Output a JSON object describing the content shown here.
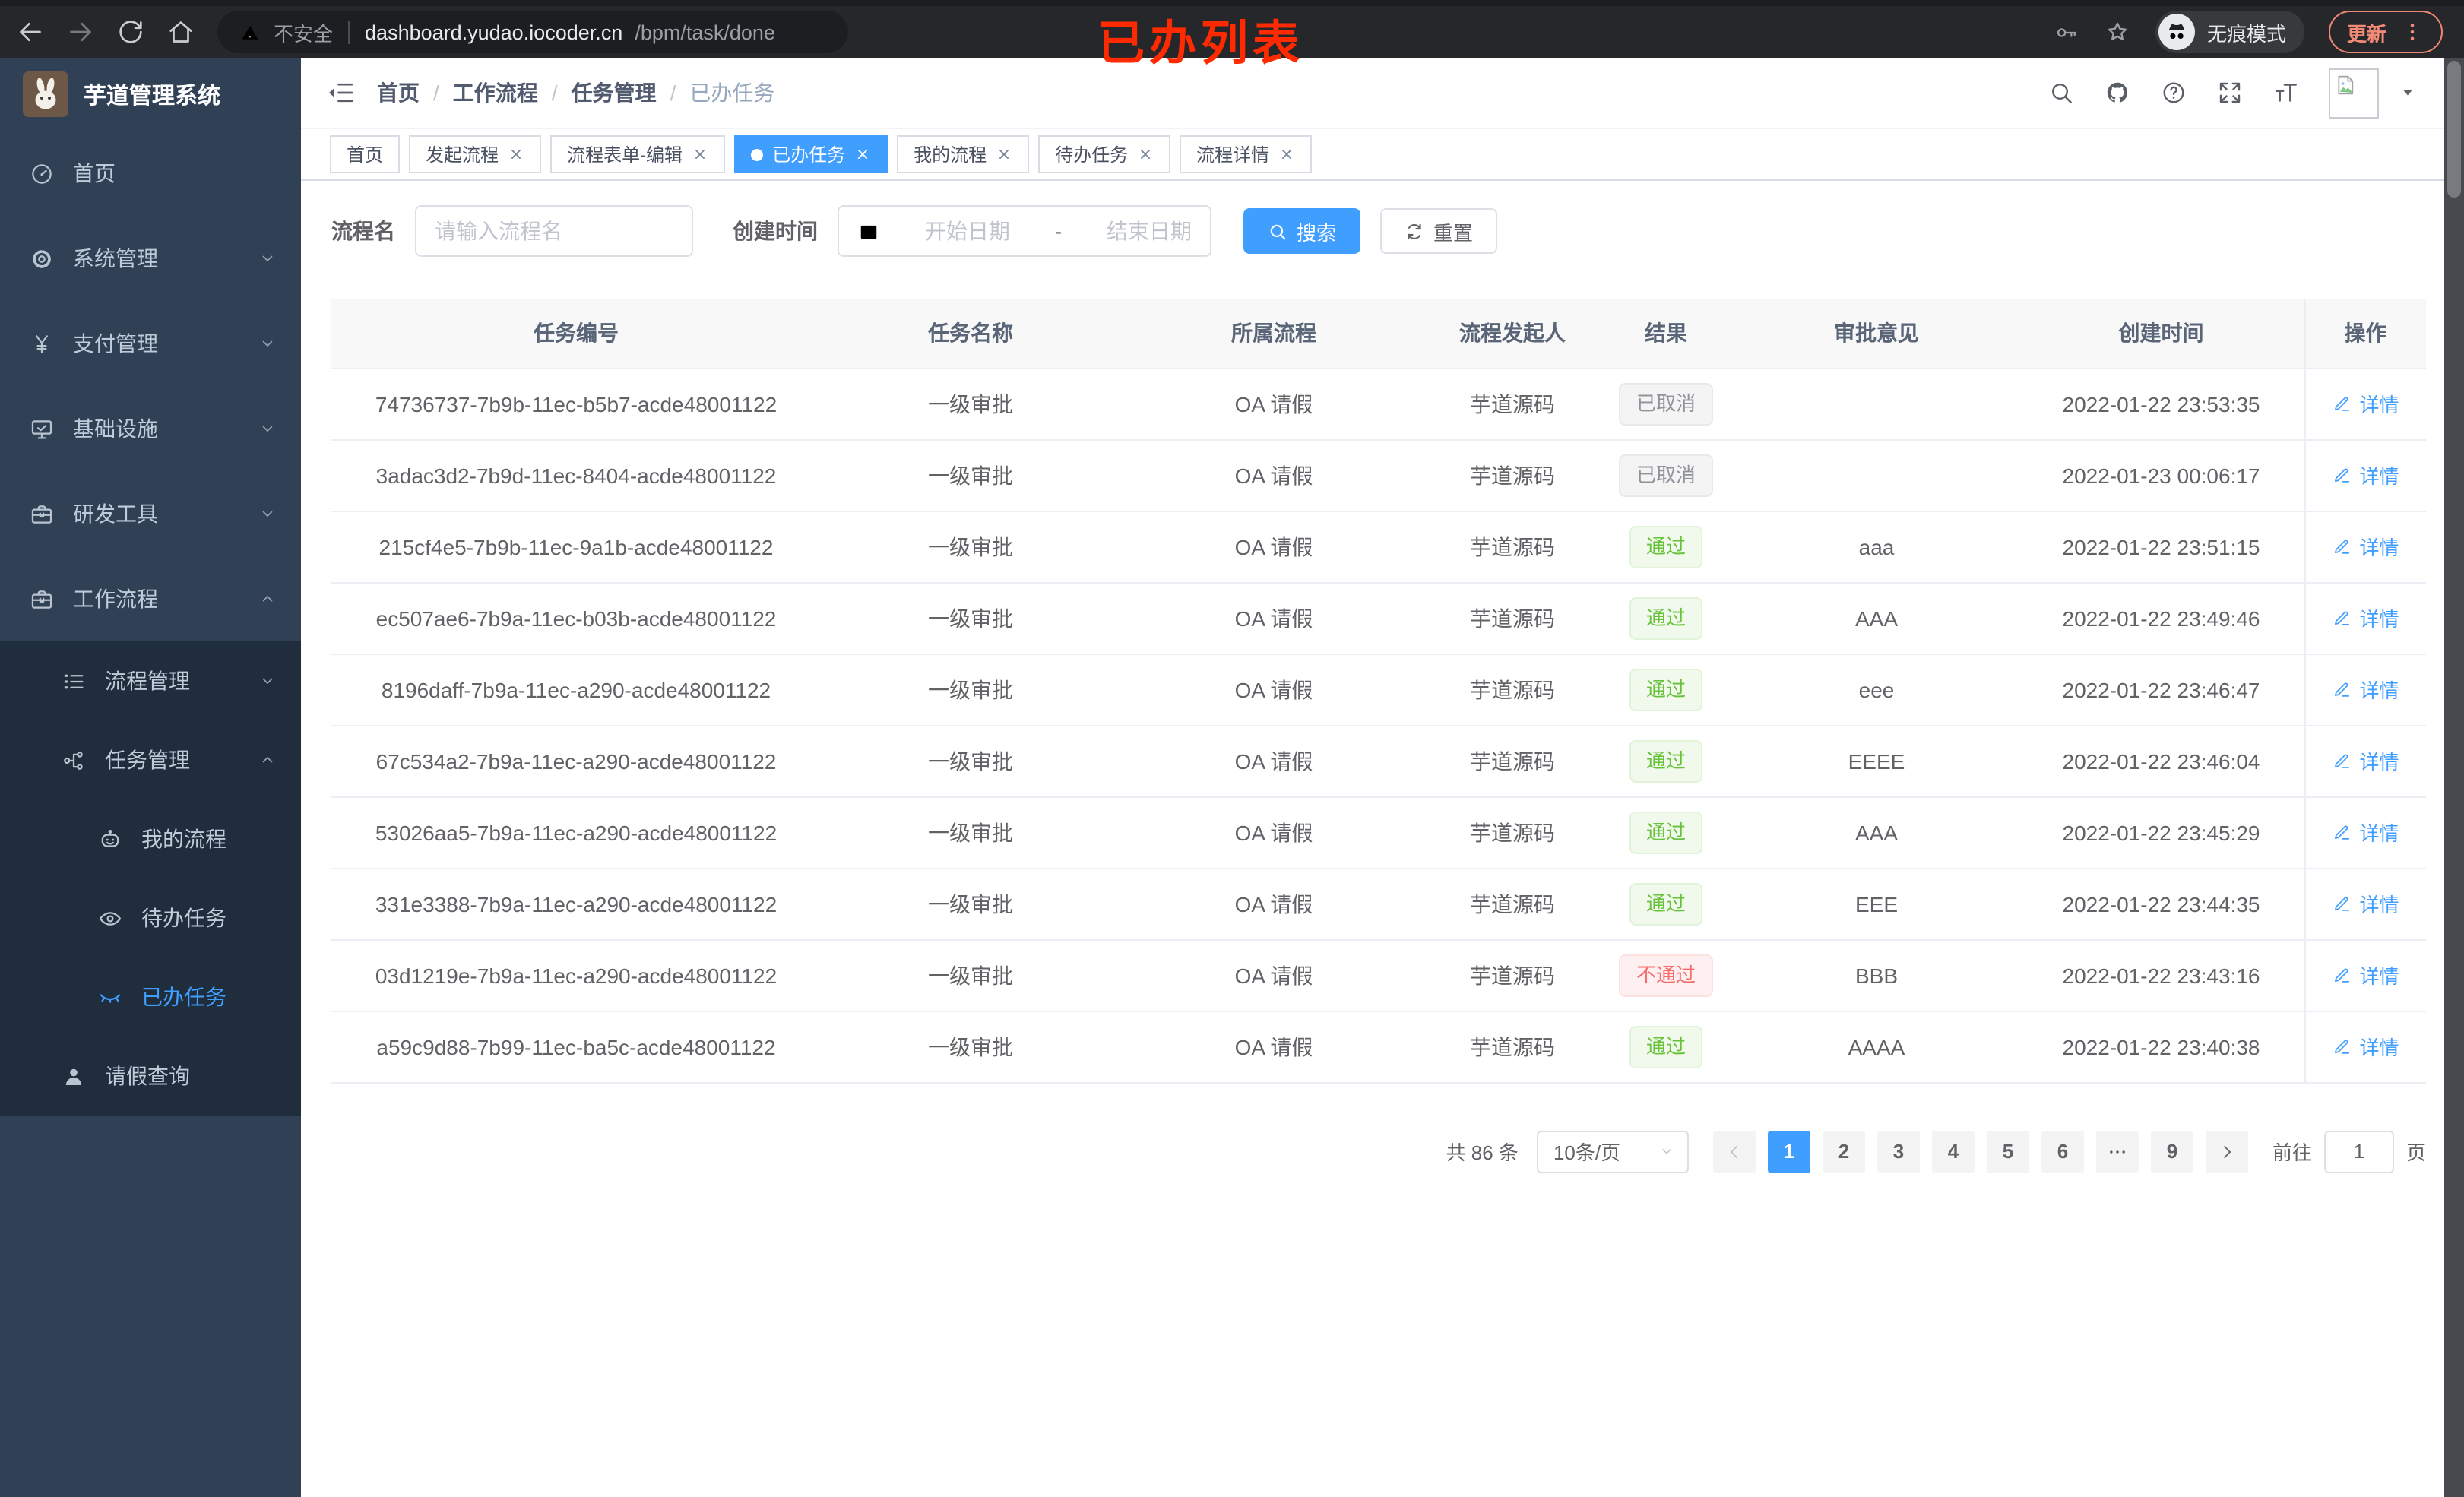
{
  "browser": {
    "security_label": "不安全",
    "url_host": "dashboard.yudao.iocoder.cn",
    "url_path": "/bpm/task/done",
    "incognito_label": "无痕模式",
    "update_label": "更新",
    "annotation": "已办列表"
  },
  "colors": {
    "accent": "#409eff",
    "sidebar_bg": "#304156",
    "submenu_bg": "#1f2d3d",
    "success": "#67c23a",
    "danger": "#f56c6c",
    "info": "#909399",
    "annotation_red": "#ff2a00"
  },
  "sidebar": {
    "title": "芋道管理系统",
    "menu": [
      {
        "id": "home",
        "label": "首页",
        "icon": "gauge-icon",
        "level": 1,
        "chevron": "none",
        "dark": false,
        "active": false
      },
      {
        "id": "system",
        "label": "系统管理",
        "icon": "gear-icon",
        "level": 1,
        "chevron": "down",
        "dark": false,
        "active": false
      },
      {
        "id": "payment",
        "label": "支付管理",
        "icon": "yen-icon",
        "level": 1,
        "chevron": "down",
        "dark": false,
        "active": false
      },
      {
        "id": "infrastructure",
        "label": "基础设施",
        "icon": "monitor-icon",
        "level": 1,
        "chevron": "down",
        "dark": false,
        "active": false
      },
      {
        "id": "dev-tools",
        "label": "研发工具",
        "icon": "toolbox-icon",
        "level": 1,
        "chevron": "down",
        "dark": false,
        "active": false
      },
      {
        "id": "workflow",
        "label": "工作流程",
        "icon": "toolbox-icon",
        "level": 1,
        "chevron": "up",
        "dark": false,
        "active": false
      },
      {
        "id": "process-manage",
        "label": "流程管理",
        "icon": "list-icon",
        "level": 2,
        "chevron": "down",
        "dark": true,
        "active": false
      },
      {
        "id": "task-manage",
        "label": "任务管理",
        "icon": "tree-icon",
        "level": 2,
        "chevron": "up",
        "dark": true,
        "active": false
      },
      {
        "id": "my-process",
        "label": "我的流程",
        "icon": "robot-icon",
        "level": 3,
        "chevron": "none",
        "dark": true,
        "active": false
      },
      {
        "id": "todo-task",
        "label": "待办任务",
        "icon": "eye-icon",
        "level": 3,
        "chevron": "none",
        "dark": true,
        "active": false
      },
      {
        "id": "done-task",
        "label": "已办任务",
        "icon": "eye-closed-icon",
        "level": 3,
        "chevron": "none",
        "dark": true,
        "active": true
      },
      {
        "id": "leave-query",
        "label": "请假查询",
        "icon": "user-icon",
        "level": 2,
        "chevron": "none",
        "dark": true,
        "active": false
      }
    ]
  },
  "navbar": {
    "breadcrumb": [
      "首页",
      "工作流程",
      "任务管理",
      "已办任务"
    ]
  },
  "tabs": [
    {
      "id": "home",
      "label": "首页",
      "closable": false,
      "active": false
    },
    {
      "id": "start-process",
      "label": "发起流程",
      "closable": true,
      "active": false
    },
    {
      "id": "form-edit",
      "label": "流程表单-编辑",
      "closable": true,
      "active": false
    },
    {
      "id": "done-task",
      "label": "已办任务",
      "closable": true,
      "active": true
    },
    {
      "id": "my-process",
      "label": "我的流程",
      "closable": true,
      "active": false
    },
    {
      "id": "todo-task",
      "label": "待办任务",
      "closable": true,
      "active": false
    },
    {
      "id": "process-detail",
      "label": "流程详情",
      "closable": true,
      "active": false
    }
  ],
  "filters": {
    "name_label": "流程名",
    "name_placeholder": "请输入流程名",
    "time_label": "创建时间",
    "start_placeholder": "开始日期",
    "range_separator": "-",
    "end_placeholder": "结束日期",
    "search_label": "搜索",
    "reset_label": "重置"
  },
  "table": {
    "columns": [
      "任务编号",
      "任务名称",
      "所属流程",
      "流程发起人",
      "结果",
      "审批意见",
      "创建时间",
      "操作"
    ],
    "action_label": "详情",
    "rows": [
      {
        "id": "74736737-7b9b-11ec-b5b7-acde48001122",
        "name": "一级审批",
        "process": "OA 请假",
        "starter": "芋道源码",
        "result": "已取消",
        "result_type": "info",
        "opinion": "",
        "time": "2022-01-22 23:53:35"
      },
      {
        "id": "3adac3d2-7b9d-11ec-8404-acde48001122",
        "name": "一级审批",
        "process": "OA 请假",
        "starter": "芋道源码",
        "result": "已取消",
        "result_type": "info",
        "opinion": "",
        "time": "2022-01-23 00:06:17"
      },
      {
        "id": "215cf4e5-7b9b-11ec-9a1b-acde48001122",
        "name": "一级审批",
        "process": "OA 请假",
        "starter": "芋道源码",
        "result": "通过",
        "result_type": "success",
        "opinion": "aaa",
        "time": "2022-01-22 23:51:15"
      },
      {
        "id": "ec507ae6-7b9a-11ec-b03b-acde48001122",
        "name": "一级审批",
        "process": "OA 请假",
        "starter": "芋道源码",
        "result": "通过",
        "result_type": "success",
        "opinion": "AAA",
        "time": "2022-01-22 23:49:46"
      },
      {
        "id": "8196daff-7b9a-11ec-a290-acde48001122",
        "name": "一级审批",
        "process": "OA 请假",
        "starter": "芋道源码",
        "result": "通过",
        "result_type": "success",
        "opinion": "eee",
        "time": "2022-01-22 23:46:47"
      },
      {
        "id": "67c534a2-7b9a-11ec-a290-acde48001122",
        "name": "一级审批",
        "process": "OA 请假",
        "starter": "芋道源码",
        "result": "通过",
        "result_type": "success",
        "opinion": "EEEE",
        "time": "2022-01-22 23:46:04"
      },
      {
        "id": "53026aa5-7b9a-11ec-a290-acde48001122",
        "name": "一级审批",
        "process": "OA 请假",
        "starter": "芋道源码",
        "result": "通过",
        "result_type": "success",
        "opinion": "AAA",
        "time": "2022-01-22 23:45:29"
      },
      {
        "id": "331e3388-7b9a-11ec-a290-acde48001122",
        "name": "一级审批",
        "process": "OA 请假",
        "starter": "芋道源码",
        "result": "通过",
        "result_type": "success",
        "opinion": "EEE",
        "time": "2022-01-22 23:44:35"
      },
      {
        "id": "03d1219e-7b9a-11ec-a290-acde48001122",
        "name": "一级审批",
        "process": "OA 请假",
        "starter": "芋道源码",
        "result": "不通过",
        "result_type": "danger",
        "opinion": "BBB",
        "time": "2022-01-22 23:43:16"
      },
      {
        "id": "a59c9d88-7b99-11ec-ba5c-acde48001122",
        "name": "一级审批",
        "process": "OA 请假",
        "starter": "芋道源码",
        "result": "通过",
        "result_type": "success",
        "opinion": "AAAA",
        "time": "2022-01-22 23:40:38"
      }
    ]
  },
  "pagination": {
    "total_label": "共 86 条",
    "page_size": "10条/页",
    "pages": [
      "1",
      "2",
      "3",
      "4",
      "5",
      "6",
      "…",
      "9"
    ],
    "active_page": "1",
    "goto_label": "前往",
    "goto_value": "1",
    "goto_suffix": "页"
  }
}
